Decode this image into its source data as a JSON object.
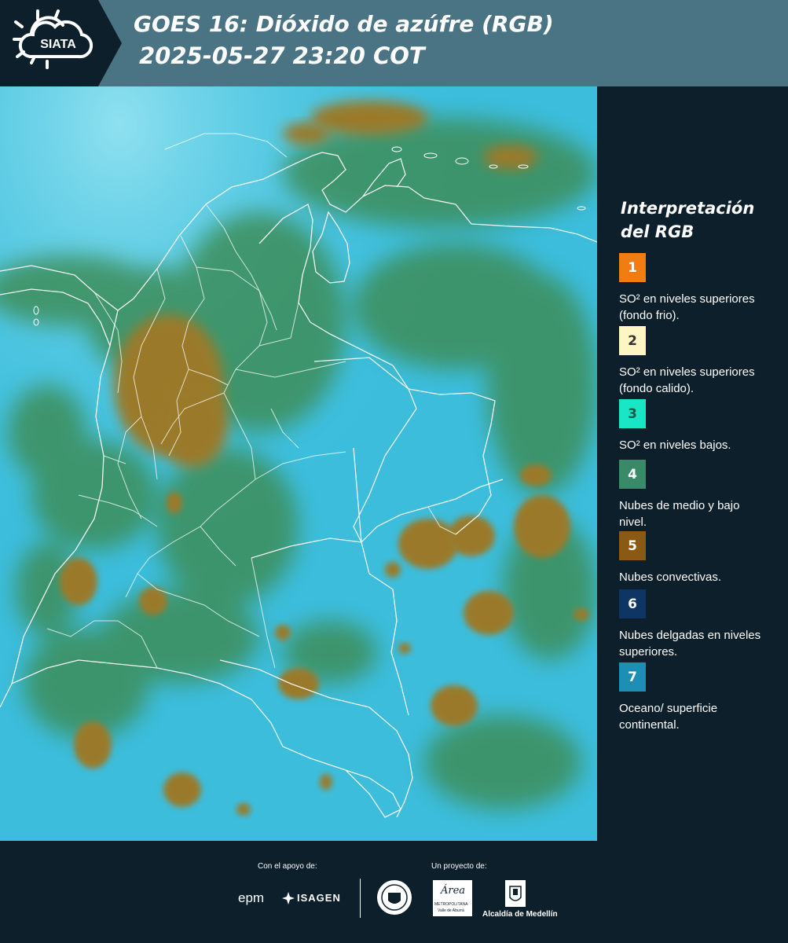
{
  "header": {
    "logo_text": "SIATA",
    "title_line1": "GOES 16: Dióxido de azúfre (RGB)",
    "title_line2": "2025-05-27 23:20 COT"
  },
  "legend": {
    "title_line1": "Interpretación",
    "title_line2": "del RGB",
    "items": [
      {
        "number": "1",
        "color": "#f07c12",
        "text": "SO² en niveles superiores (fondo frio)."
      },
      {
        "number": "2",
        "color": "#fdf6c4",
        "text": "SO² en niveles superiores (fondo calido)."
      },
      {
        "number": "3",
        "color": "#18e6c4",
        "text": "SO² en niveles bajos."
      },
      {
        "number": "4",
        "color": "#3a8a6a",
        "text": "Nubes de medio y bajo nivel."
      },
      {
        "number": "5",
        "color": "#8a5a14",
        "text": "Nubes convectivas."
      },
      {
        "number": "6",
        "color": "#0f3564",
        "text": "Nubes delgadas en niveles superiores."
      },
      {
        "number": "7",
        "color": "#1e8fb4",
        "text": "Oceano/ superficie continental."
      }
    ]
  },
  "footer": {
    "support_caption": "Con el apoyo de:",
    "project_caption": "Un proyecto de:",
    "epm_text": "epm",
    "isagen_text": "ISAGEN",
    "area_text": "Área",
    "area_subtext": "METROPOLITANA",
    "area_subtext2": "Valle de Aburrá",
    "alcaldia_text": "Alcaldía de Medellín"
  }
}
